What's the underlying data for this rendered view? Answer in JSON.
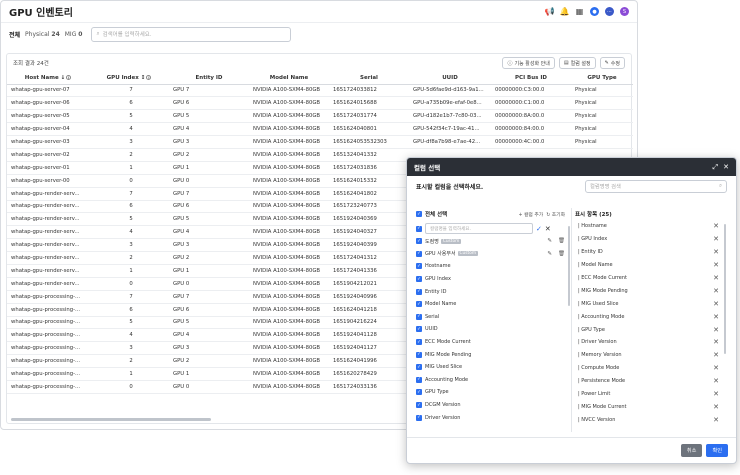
{
  "header": {
    "title": "GPU 인벤토리",
    "avatar_letter": "S"
  },
  "filter": {
    "tab_all": "전체",
    "tab_physical": "Physical",
    "physical_count": "24",
    "tab_mig": "MIG",
    "mig_count": "0",
    "search_placeholder": "검색어를 입력하세요."
  },
  "toolbar": {
    "result_count": "조회 결과 24건",
    "feature_btn": "기능 활성화 안내",
    "column_btn": "컬럼 설정",
    "edit_btn": "수정"
  },
  "table": {
    "columns": [
      "Host Name",
      "GPU Index",
      "Entity ID",
      "Model Name",
      "Serial",
      "UUID",
      "PCI Bus ID",
      "GPU Type"
    ],
    "rows": [
      [
        "whatap-gpu-server-07",
        "7",
        "GPU 7",
        "NVIDIA A100-SXM4-80GB",
        "1651724033812",
        "GPU-5d6fae9d-d163-9a1...",
        "00000000:C3:00.0",
        "Physical"
      ],
      [
        "whatap-gpu-server-06",
        "6",
        "GPU 6",
        "NVIDIA A100-SXM4-80GB",
        "1651624015688",
        "GPU-a735b09e-efaf-0e8...",
        "00000000:C1:00.0",
        "Physical"
      ],
      [
        "whatap-gpu-server-05",
        "5",
        "GPU 5",
        "NVIDIA A100-SXM4-80GB",
        "1651724031774",
        "GPU-d182e1b7-7c80-03...",
        "00000000:8A:00.0",
        "Physical"
      ],
      [
        "whatap-gpu-server-04",
        "4",
        "GPU 4",
        "NVIDIA A100-SXM4-80GB",
        "1651624040801",
        "GPU-542f34c7-19ac-41...",
        "00000000:84:00.0",
        "Physical"
      ],
      [
        "whatap-gpu-server-03",
        "3",
        "GPU 3",
        "NVIDIA A100-SXM4-80GB",
        "1651624053532303",
        "GPU-df8a7b98-e7ae-42...",
        "00000000:4C:00.0",
        "Physical"
      ],
      [
        "whatap-gpu-server-02",
        "2",
        "GPU 2",
        "NVIDIA A100-SXM4-80GB",
        "1651324041332",
        "",
        "",
        ""
      ],
      [
        "whatap-gpu-server-01",
        "1",
        "GPU 1",
        "NVIDIA A100-SXM4-80GB",
        "1651724031836",
        "",
        "",
        ""
      ],
      [
        "whatap-gpu-server-00",
        "0",
        "GPU 0",
        "NVIDIA A100-SXM4-80GB",
        "1651624015332",
        "",
        "",
        ""
      ],
      [
        "whatap-gpu-render-serv...",
        "7",
        "GPU 7",
        "NVIDIA A100-SXM4-80GB",
        "1651624041802",
        "",
        "",
        ""
      ],
      [
        "whatap-gpu-render-serv...",
        "6",
        "GPU 6",
        "NVIDIA A100-SXM4-80GB",
        "1651723240773",
        "",
        "",
        ""
      ],
      [
        "whatap-gpu-render-serv...",
        "5",
        "GPU 5",
        "NVIDIA A100-SXM4-80GB",
        "1651924040369",
        "",
        "",
        ""
      ],
      [
        "whatap-gpu-render-serv...",
        "4",
        "GPU 4",
        "NVIDIA A100-SXM4-80GB",
        "1651924040327",
        "",
        "",
        ""
      ],
      [
        "whatap-gpu-render-serv...",
        "3",
        "GPU 3",
        "NVIDIA A100-SXM4-80GB",
        "1651924040399",
        "",
        "",
        ""
      ],
      [
        "whatap-gpu-render-serv...",
        "2",
        "GPU 2",
        "NVIDIA A100-SXM4-80GB",
        "1651724041312",
        "",
        "",
        ""
      ],
      [
        "whatap-gpu-render-serv...",
        "1",
        "GPU 1",
        "NVIDIA A100-SXM4-80GB",
        "1651724041336",
        "",
        "",
        ""
      ],
      [
        "whatap-gpu-render-serv...",
        "0",
        "GPU 0",
        "NVIDIA A100-SXM4-80GB",
        "1651904212021",
        "",
        "",
        ""
      ],
      [
        "whatap-gpu-processing-...",
        "7",
        "GPU 7",
        "NVIDIA A100-SXM4-80GB",
        "1651924040996",
        "",
        "",
        ""
      ],
      [
        "whatap-gpu-processing-...",
        "6",
        "GPU 6",
        "NVIDIA A100-SXM4-80GB",
        "1651624041218",
        "",
        "",
        ""
      ],
      [
        "whatap-gpu-processing-...",
        "5",
        "GPU 5",
        "NVIDIA A100-SXM4-80GB",
        "1651904216224",
        "",
        "",
        ""
      ],
      [
        "whatap-gpu-processing-...",
        "4",
        "GPU 4",
        "NVIDIA A100-SXM4-80GB",
        "1651924041128",
        "",
        "",
        ""
      ],
      [
        "whatap-gpu-processing-...",
        "3",
        "GPU 3",
        "NVIDIA A100-SXM4-80GB",
        "1651924041127",
        "",
        "",
        ""
      ],
      [
        "whatap-gpu-processing-...",
        "2",
        "GPU 2",
        "NVIDIA A100-SXM4-80GB",
        "1651624041996",
        "",
        "",
        ""
      ],
      [
        "whatap-gpu-processing-...",
        "1",
        "GPU 1",
        "NVIDIA A100-SXM4-80GB",
        "1651620278429",
        "",
        "",
        ""
      ],
      [
        "whatap-gpu-processing-...",
        "0",
        "GPU 0",
        "NVIDIA A100-SXM4-80GB",
        "1651724033136",
        "",
        "",
        ""
      ]
    ]
  },
  "modal": {
    "title": "컬럼 선택",
    "subtitle": "표시할 컬럼을 선택하세요.",
    "search_placeholder": "컬럼명명 검색",
    "select_all": "전체 선택",
    "add_group": "+ 컬럼 추가",
    "reset": "초기화",
    "group_placeholder": "컬럼명을 입력하세요.",
    "custom_tag": "Custom",
    "left_items": [
      {
        "label": "도컴명",
        "custom": true
      },
      {
        "label": "GPU 사용부서",
        "custom": true
      },
      {
        "label": "Hostname",
        "custom": false
      },
      {
        "label": "GPU Index",
        "custom": false
      },
      {
        "label": "Entity ID",
        "custom": false
      },
      {
        "label": "Model Name",
        "custom": false
      },
      {
        "label": "Serial",
        "custom": false
      },
      {
        "label": "UUID",
        "custom": false
      },
      {
        "label": "ECC Mode Current",
        "custom": false
      },
      {
        "label": "MIG Mode Pending",
        "custom": false
      },
      {
        "label": "MIG Used Slice",
        "custom": false
      },
      {
        "label": "Accounting Mode",
        "custom": false
      },
      {
        "label": "GPU Type",
        "custom": false
      },
      {
        "label": "DCGM Version",
        "custom": false
      },
      {
        "label": "Driver Version",
        "custom": false
      }
    ],
    "right_title": "표시 항목 (25)",
    "right_items": [
      "| Hostname",
      "| GPU Index",
      "| Entity ID",
      "| Model Name",
      "| ECC Mode Current",
      "| MIG Mode Pending",
      "| MIG Used Slice",
      "| Accounting Mode",
      "| GPU Type",
      "| Driver Version",
      "| Memory Version",
      "| Compute Mode",
      "| Persistence Mode",
      "| Power Limit",
      "| MIG Mode Current",
      "| NVCC Version"
    ],
    "cancel": "취소",
    "confirm": "확인"
  }
}
